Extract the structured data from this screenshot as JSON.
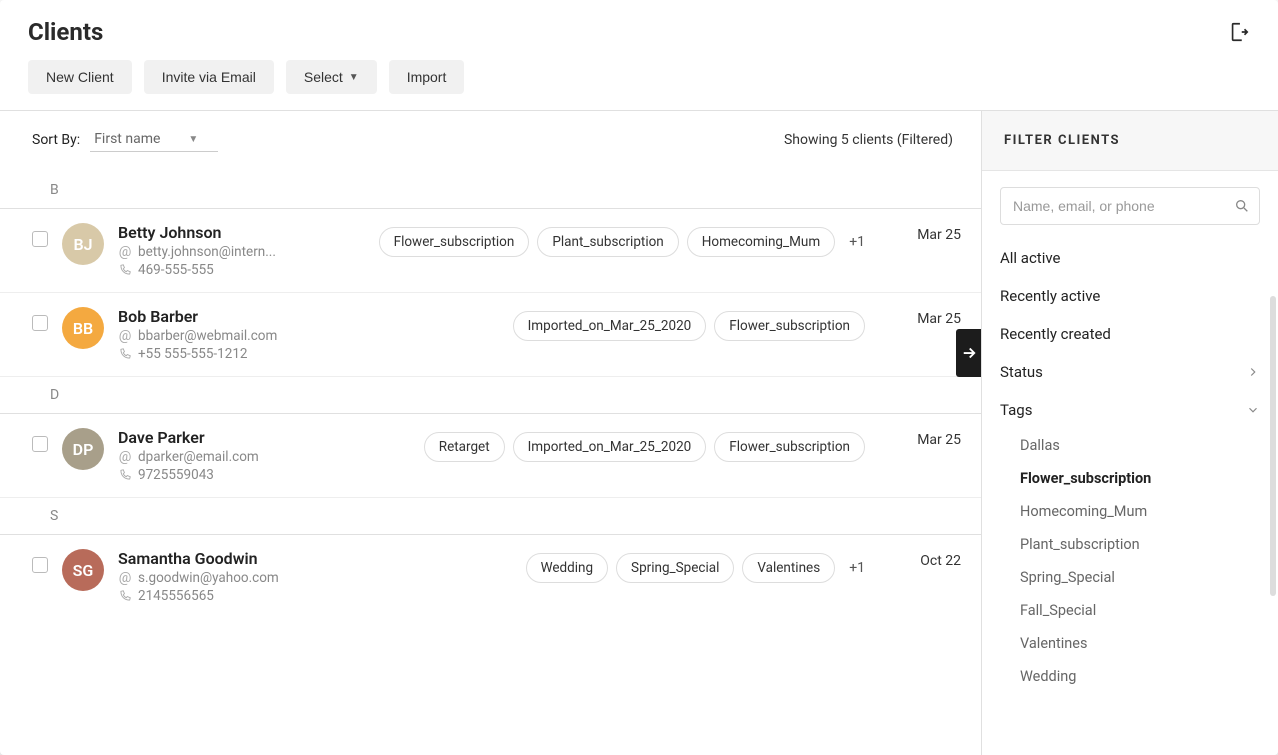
{
  "header": {
    "title": "Clients",
    "toolbar": {
      "new_client": "New Client",
      "invite": "Invite via Email",
      "select": "Select",
      "import": "Import"
    }
  },
  "sort": {
    "label": "Sort By:",
    "value": "First name",
    "showing": "Showing 5 clients (Filtered)"
  },
  "sections": [
    {
      "letter": "B",
      "clients": [
        {
          "name": "Betty Johnson",
          "email": "betty.johnson@intern...",
          "phone": "469-555-555",
          "avatar_bg": "#d8c9a8",
          "initials": "BJ",
          "tags": [
            "Flower_subscription",
            "Plant_subscription",
            "Homecoming_Mum"
          ],
          "overflow": "+1",
          "date": "Mar 25"
        },
        {
          "name": "Bob Barber",
          "email": "bbarber@webmail.com",
          "phone": "+55 555-555-1212",
          "avatar_bg": "#f4a940",
          "initials": "BB",
          "tags": [
            "Imported_on_Mar_25_2020",
            "Flower_subscription"
          ],
          "overflow": "",
          "date": "Mar 25"
        }
      ]
    },
    {
      "letter": "D",
      "clients": [
        {
          "name": "Dave Parker",
          "email": "dparker@email.com",
          "phone": "9725559043",
          "avatar_bg": "#a89f8a",
          "initials": "DP",
          "tags": [
            "Retarget",
            "Imported_on_Mar_25_2020",
            "Flower_subscription"
          ],
          "overflow": "",
          "date": "Mar 25"
        }
      ]
    },
    {
      "letter": "S",
      "clients": [
        {
          "name": "Samantha Goodwin",
          "email": "s.goodwin@yahoo.com",
          "phone": "2145556565",
          "avatar_bg": "#b86b5a",
          "initials": "SG",
          "tags": [
            "Wedding",
            "Spring_Special",
            "Valentines"
          ],
          "overflow": "+1",
          "date": "Oct 22"
        }
      ]
    }
  ],
  "filter": {
    "title": "FILTER CLIENTS",
    "search_placeholder": "Name, email, or phone",
    "quick": {
      "all_active": "All active",
      "recently_active": "Recently active",
      "recently_created": "Recently created",
      "status": "Status",
      "tags": "Tags"
    },
    "tags": [
      {
        "label": "Dallas",
        "active": false
      },
      {
        "label": "Flower_subscription",
        "active": true
      },
      {
        "label": "Homecoming_Mum",
        "active": false
      },
      {
        "label": "Plant_subscription",
        "active": false
      },
      {
        "label": "Spring_Special",
        "active": false
      },
      {
        "label": "Fall_Special",
        "active": false
      },
      {
        "label": "Valentines",
        "active": false
      },
      {
        "label": "Wedding",
        "active": false
      }
    ]
  }
}
